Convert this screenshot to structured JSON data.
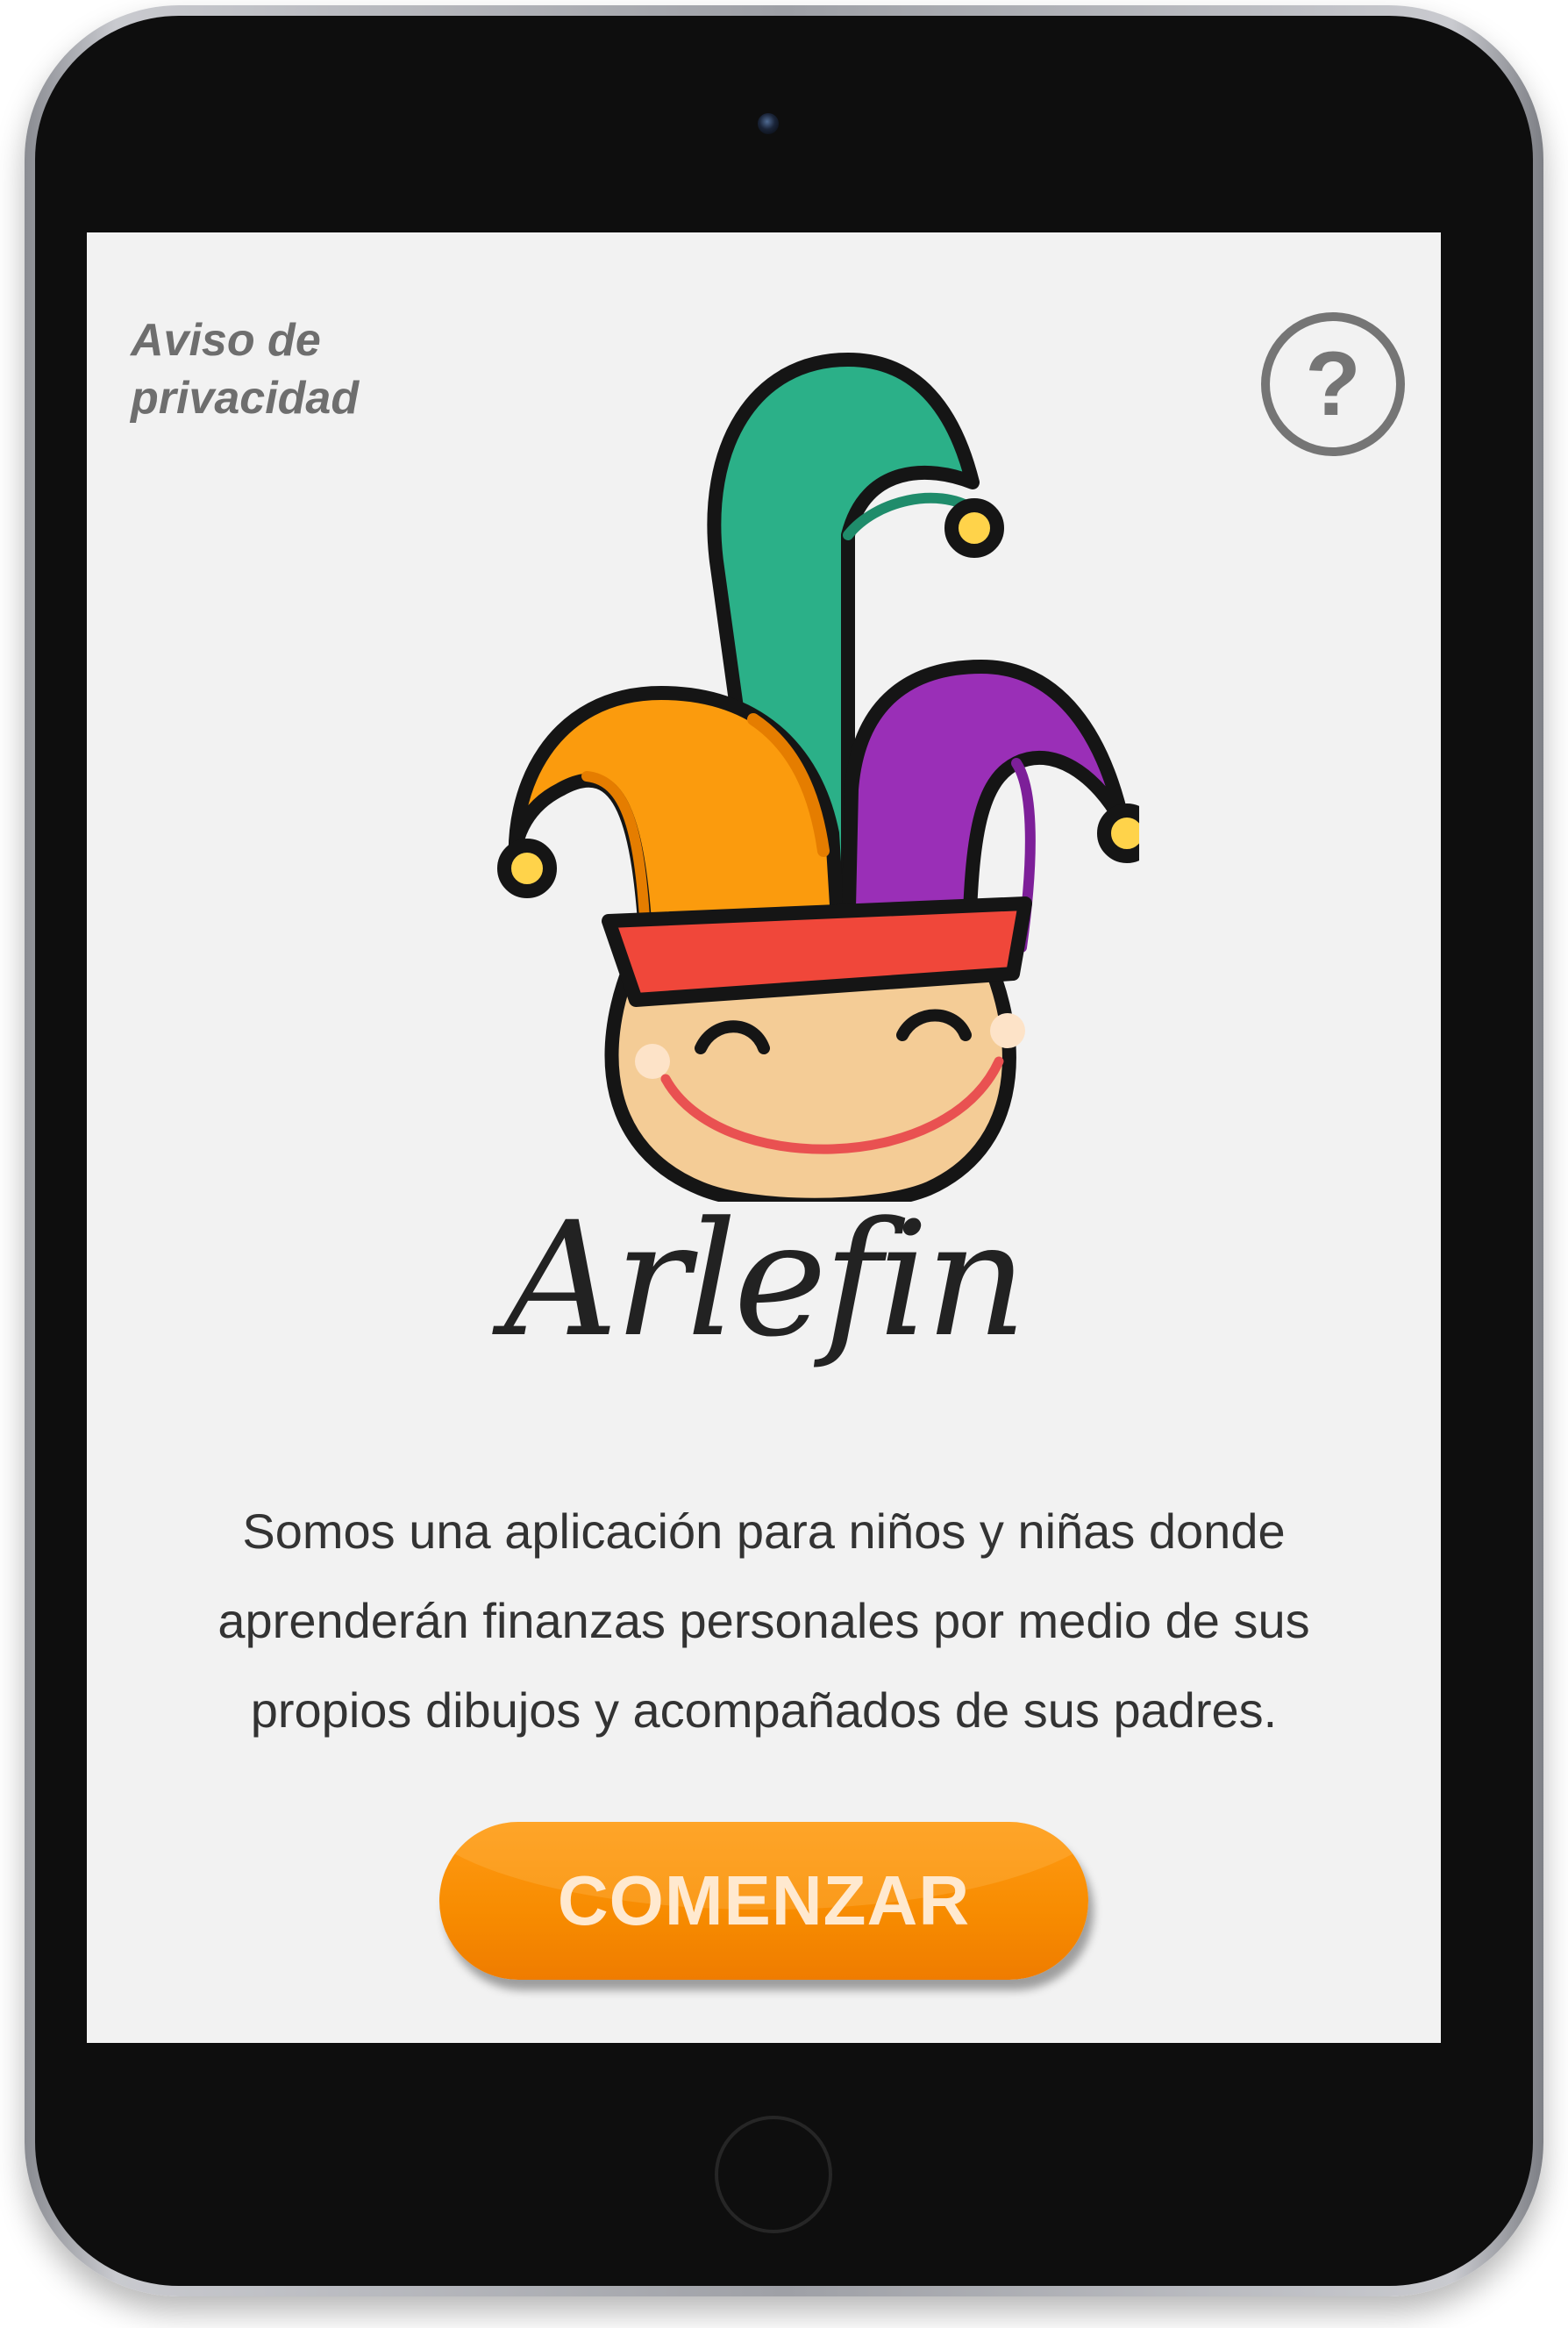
{
  "header": {
    "privacy_label": "Aviso de\nprivacidad",
    "help_symbol": "?"
  },
  "brand": {
    "name": "Arlefin"
  },
  "main": {
    "description": "Somos una aplicación para niños y niñas donde aprenderán finanzas personales por medio de sus propios dibujos y acompañados de sus padres."
  },
  "cta": {
    "start_label": "COMENZAR"
  },
  "icons": {
    "help": "question-circle-icon",
    "mascot": "jester-mascot-icon"
  },
  "colors": {
    "background": "#f2f2f2",
    "accent_orange": "#f78b00",
    "text": "#333333",
    "muted": "#6e6e6e"
  }
}
